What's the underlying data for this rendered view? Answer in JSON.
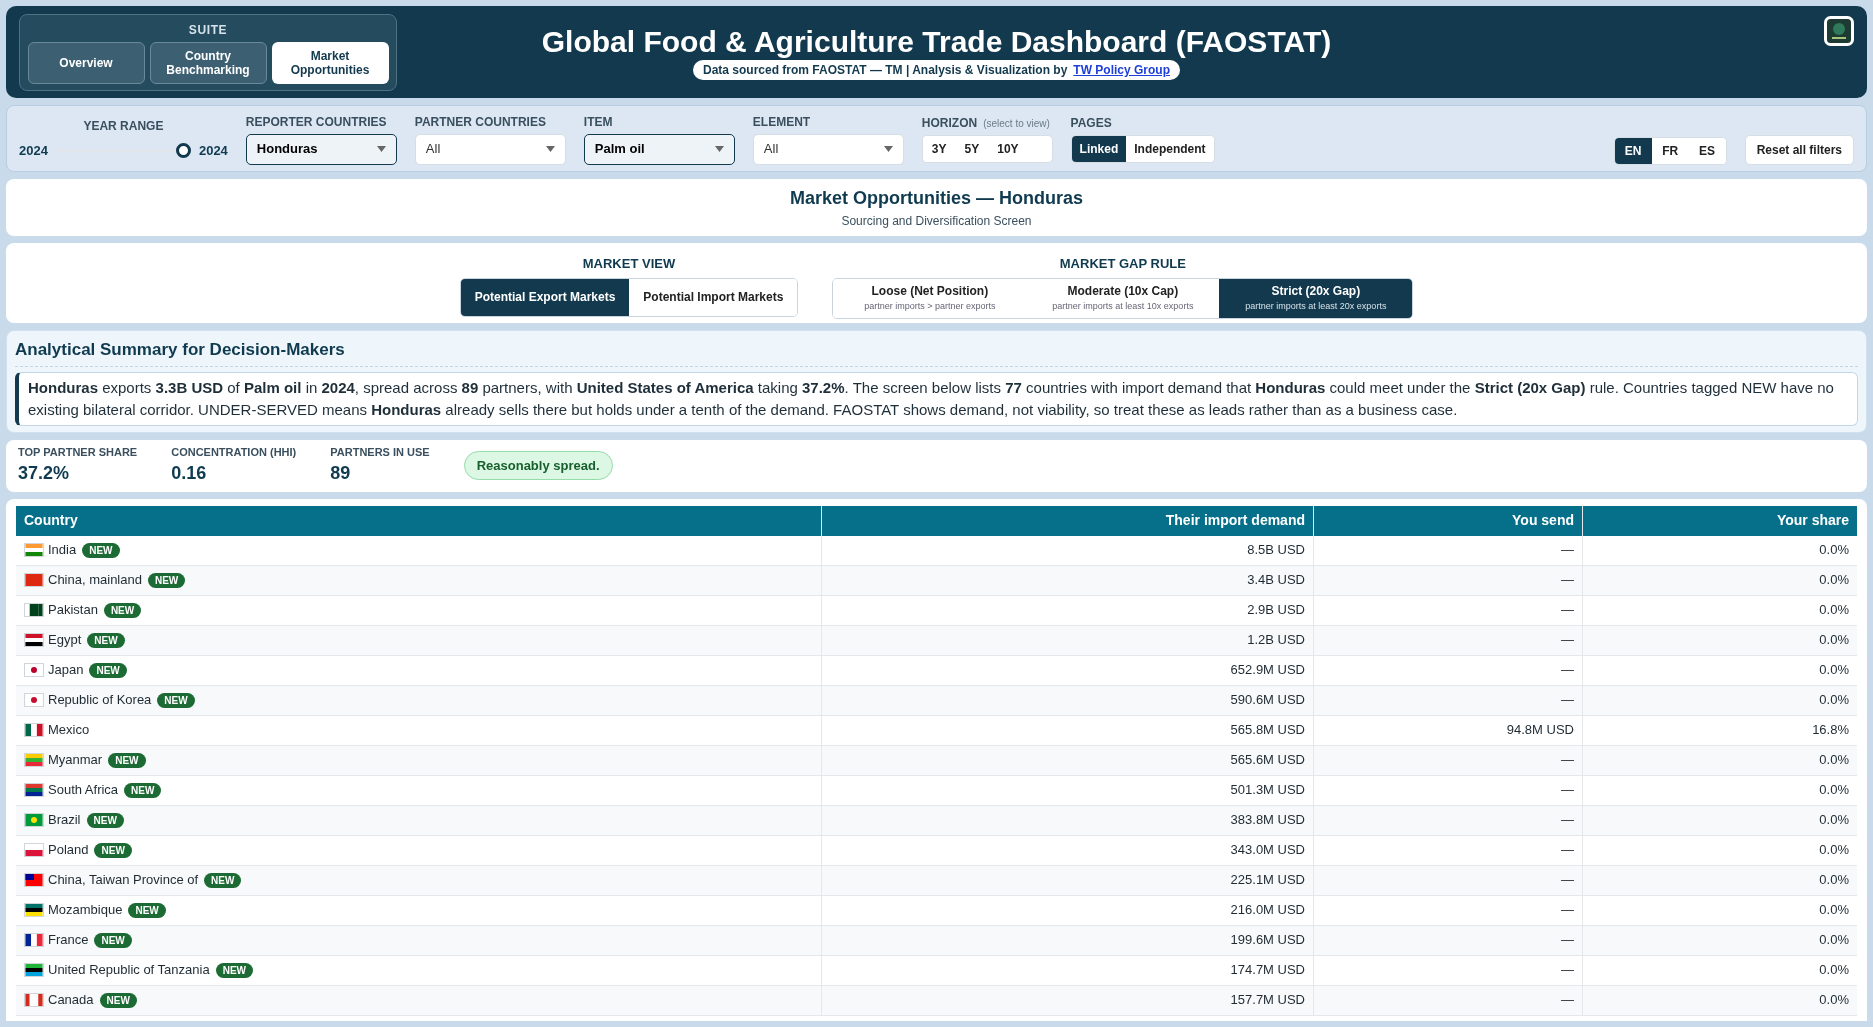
{
  "header": {
    "suite_label": "SUITE",
    "suite_tabs": [
      {
        "label": "Overview",
        "selected": false
      },
      {
        "label": "Country Benchmarking",
        "selected": false
      },
      {
        "label": "Market Opportunities",
        "selected": true
      }
    ],
    "title": "Global Food & Agriculture Trade Dashboard (FAOSTAT)",
    "source_text": "Data sourced from FAOSTAT — TM | Analysis & Visualization by",
    "source_link": "TW Policy Group"
  },
  "filters": {
    "year_range": {
      "label": "YEAR RANGE",
      "from": "2024",
      "to": "2024",
      "level": 1
    },
    "dropdowns": [
      {
        "label": "REPORTER COUNTRIES",
        "value": "Honduras",
        "highlighted": true
      },
      {
        "label": "PARTNER COUNTRIES",
        "value": "All",
        "highlighted": false
      },
      {
        "label": "ITEM",
        "value": "Palm oil",
        "highlighted": true
      },
      {
        "label": "ELEMENT",
        "value": "All",
        "highlighted": false
      }
    ],
    "horizon": {
      "label": "HORIZON",
      "hint": "(select to view)",
      "options": [
        {
          "label": "3Y",
          "selected": false
        },
        {
          "label": "5Y",
          "selected": false
        },
        {
          "label": "10Y",
          "selected": false
        }
      ]
    },
    "pages": {
      "label": "PAGES",
      "options": [
        {
          "label": "Linked",
          "selected": true
        },
        {
          "label": "Independent",
          "selected": false
        }
      ]
    },
    "languages": [
      {
        "label": "EN",
        "selected": true
      },
      {
        "label": "FR",
        "selected": false
      },
      {
        "label": "ES",
        "selected": false
      }
    ],
    "reset_button": "Reset all filters"
  },
  "page_title": "Market Opportunities — Honduras",
  "page_subtitle": "Sourcing and Diversification Screen",
  "market_view": {
    "label": "MARKET VIEW",
    "options": [
      {
        "label": "Potential Export Markets",
        "selected": true
      },
      {
        "label": "Potential Import Markets",
        "selected": false
      }
    ]
  },
  "gap_rule": {
    "label": "MARKET GAP RULE",
    "options": [
      {
        "label": "Loose (Net Position)",
        "hint": "partner imports > partner exports",
        "selected": false
      },
      {
        "label": "Moderate (10x Cap)",
        "hint": "partner imports at least 10x exports",
        "selected": false
      },
      {
        "label": "Strict (20x Gap)",
        "hint": "partner imports at least 20x exports",
        "selected": true
      }
    ]
  },
  "summary": {
    "title": "Analytical Summary for Decision-Makers",
    "text": "**Honduras** exports **3.3B USD** of **Palm oil** in **2024**, spread across **89** partners, with **United States of America** taking **37.2%**. The screen below lists **77** countries with import demand that **Honduras** could meet under the **Strict (20x Gap)** rule. Countries tagged NEW have no existing bilateral corridor. UNDER-SERVED means **Honduras** already sells there but holds under a tenth of the demand. FAOSTAT shows demand, not viability, so treat these as leads rather than as a business case."
  },
  "stats": [
    {
      "label": "TOP PARTNER SHARE",
      "value": "37.2%"
    },
    {
      "label": "CONCENTRATION (HHI)",
      "value": "0.16"
    },
    {
      "label": "PARTNERS IN USE",
      "value": "89"
    }
  ],
  "stats_badge": "Reasonably spread.",
  "table": {
    "columns": [
      "Country",
      "Their import demand",
      "You send",
      "Your share"
    ],
    "rows": [
      {
        "country": "India",
        "tag": "NEW",
        "demand": "8.5B USD",
        "send": "—",
        "share": "0.0%"
      },
      {
        "country": "China, mainland",
        "tag": "NEW",
        "demand": "3.4B USD",
        "send": "—",
        "share": "0.0%"
      },
      {
        "country": "Pakistan",
        "tag": "NEW",
        "demand": "2.9B USD",
        "send": "—",
        "share": "0.0%"
      },
      {
        "country": "Egypt",
        "tag": "NEW",
        "demand": "1.2B USD",
        "send": "—",
        "share": "0.0%"
      },
      {
        "country": "Japan",
        "tag": "NEW",
        "demand": "652.9M USD",
        "send": "—",
        "share": "0.0%"
      },
      {
        "country": "Republic of Korea",
        "tag": "NEW",
        "demand": "590.6M USD",
        "send": "—",
        "share": "0.0%"
      },
      {
        "country": "Mexico",
        "demand": "565.8M USD",
        "send": "94.8M USD",
        "share": "16.8%"
      },
      {
        "country": "Myanmar",
        "tag": "NEW",
        "demand": "565.6M USD",
        "send": "—",
        "share": "0.0%"
      },
      {
        "country": "South Africa",
        "tag": "NEW",
        "demand": "501.3M USD",
        "send": "—",
        "share": "0.0%"
      },
      {
        "country": "Brazil",
        "tag": "NEW",
        "demand": "383.8M USD",
        "send": "—",
        "share": "0.0%"
      },
      {
        "country": "Poland",
        "tag": "NEW",
        "demand": "343.0M USD",
        "send": "—",
        "share": "0.0%"
      },
      {
        "country": "China, Taiwan Province of",
        "tag": "NEW",
        "demand": "225.1M USD",
        "send": "—",
        "share": "0.0%"
      },
      {
        "country": "Mozambique",
        "tag": "NEW",
        "demand": "216.0M USD",
        "send": "—",
        "share": "0.0%"
      },
      {
        "country": "France",
        "tag": "NEW",
        "demand": "199.6M USD",
        "send": "—",
        "share": "0.0%"
      },
      {
        "country": "United Republic of Tanzania",
        "tag": "NEW",
        "demand": "174.7M USD",
        "send": "—",
        "share": "0.0%"
      },
      {
        "country": "Canada",
        "tag": "NEW",
        "demand": "157.7M USD",
        "send": "—",
        "share": "0.0%"
      }
    ]
  }
}
